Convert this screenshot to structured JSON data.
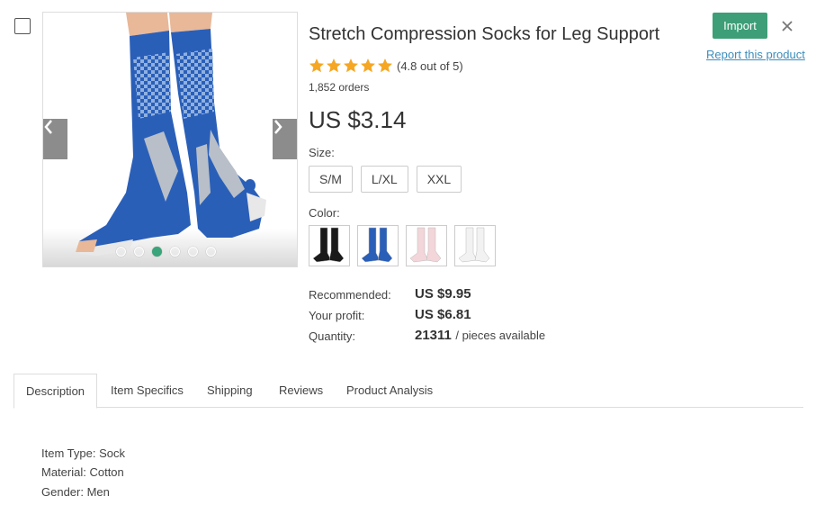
{
  "product": {
    "title": "Stretch Compression Socks for Leg Support",
    "rating_text": "(4.8 out of 5)",
    "rating_value": 4.8,
    "rating_max": 5,
    "orders": "1,852 orders",
    "price": "US $3.14"
  },
  "actions": {
    "import_label": "Import",
    "report_label": "Report this product",
    "close_icon": "close-icon"
  },
  "options": {
    "size_label": "Size:",
    "sizes": [
      "S/M",
      "L/XL",
      "XXL"
    ],
    "color_label": "Color:",
    "colors": [
      {
        "name": "black",
        "hex": "#1a1a1a"
      },
      {
        "name": "blue",
        "hex": "#2a5fb8"
      },
      {
        "name": "pink",
        "hex": "#f2d6d9"
      },
      {
        "name": "white",
        "hex": "#f2f2f2"
      }
    ]
  },
  "pricing": {
    "recommended_label": "Recommended:",
    "recommended_value": "US $9.95",
    "profit_label": "Your profit:",
    "profit_value": "US $6.81",
    "quantity_label": "Quantity:",
    "quantity_value": "21311",
    "quantity_suffix": "/ pieces available"
  },
  "gallery": {
    "dot_count": 6,
    "active_dot": 2
  },
  "tabs": [
    "Description",
    "Item Specifics",
    "Shipping",
    "Reviews",
    "Product Analysis"
  ],
  "active_tab": "Description",
  "description": [
    "Item Type: Sock",
    "Material: Cotton",
    "Gender: Men"
  ],
  "theme": {
    "accent": "#3d9e77",
    "star": "#f5a623",
    "link": "#3c8dbc"
  }
}
